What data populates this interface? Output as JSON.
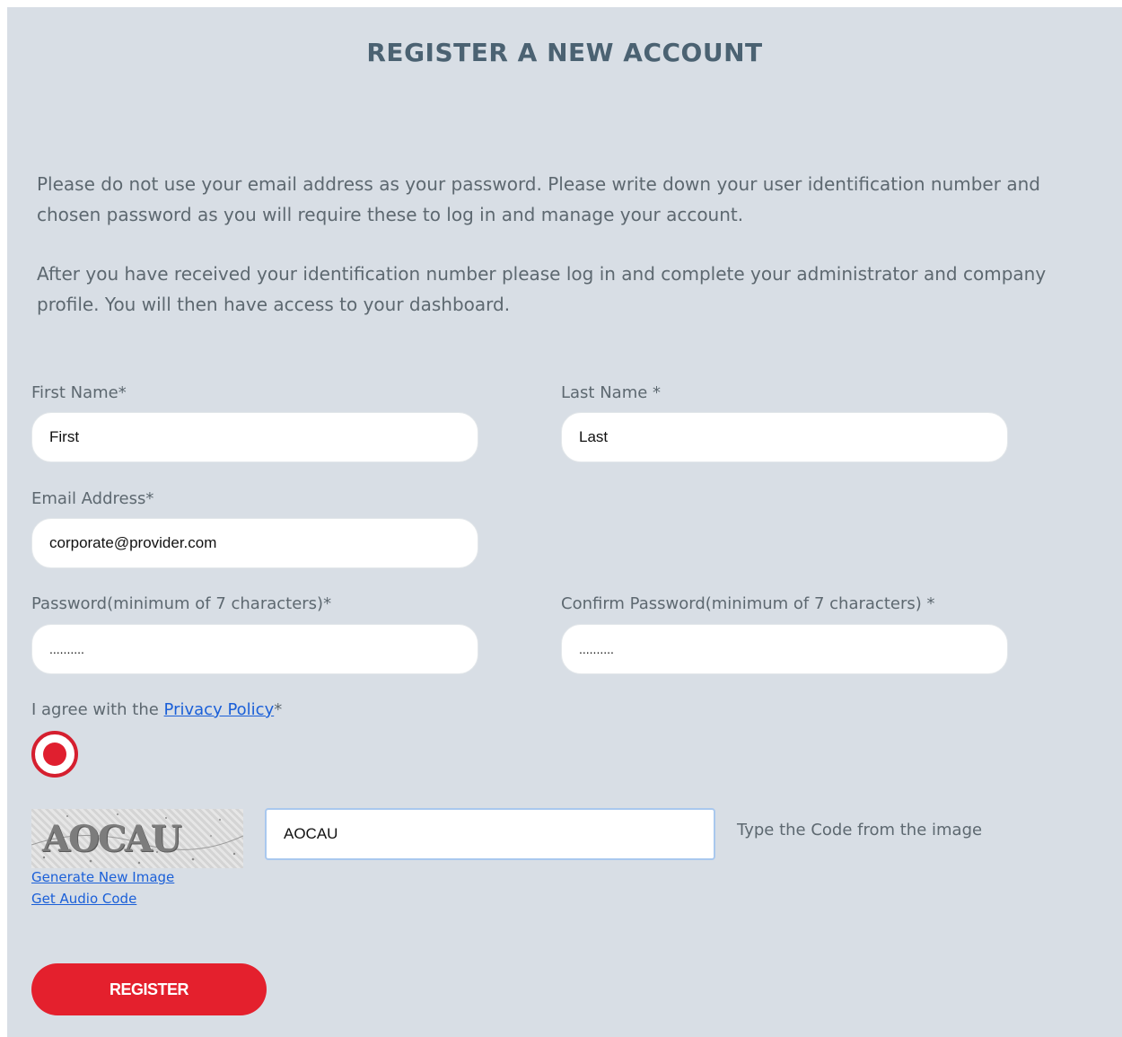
{
  "page": {
    "title": "REGISTER A NEW ACCOUNT",
    "paragraphs": [
      "Please do not use your email address as your password. Please write down your user identification number and chosen password as you will require these to log in and manage your account.",
      "After you have received your identification number please log in and complete your administrator and company profile. You will then have access to your dashboard."
    ]
  },
  "form": {
    "first_name": {
      "label": "First Name*",
      "value": "First"
    },
    "last_name": {
      "label": "Last Name *",
      "value": "Last"
    },
    "email": {
      "label": "Email Address*",
      "value": "corporate@provider.com"
    },
    "password": {
      "label": "Password(minimum of 7 characters)*",
      "value": "..........",
      "masked": "··········"
    },
    "confirm_password": {
      "label": "Confirm Password(minimum of 7 characters) *",
      "value": "..........",
      "masked": "··········"
    },
    "privacy": {
      "prefix": "I agree with the ",
      "link_text": "Privacy Policy",
      "suffix": "*",
      "selected": true
    },
    "captcha": {
      "image_text": "AOCAU",
      "input_value": "AOCAU",
      "hint": "Type the Code from the image",
      "generate_link": "Generate New Image",
      "audio_link": "Get Audio Code"
    },
    "submit_label": "REGISTER"
  },
  "colors": {
    "panel_bg": "#d8dee5",
    "title": "#4b6272",
    "accent_red": "#e4202d",
    "link": "#1a5fd8"
  }
}
